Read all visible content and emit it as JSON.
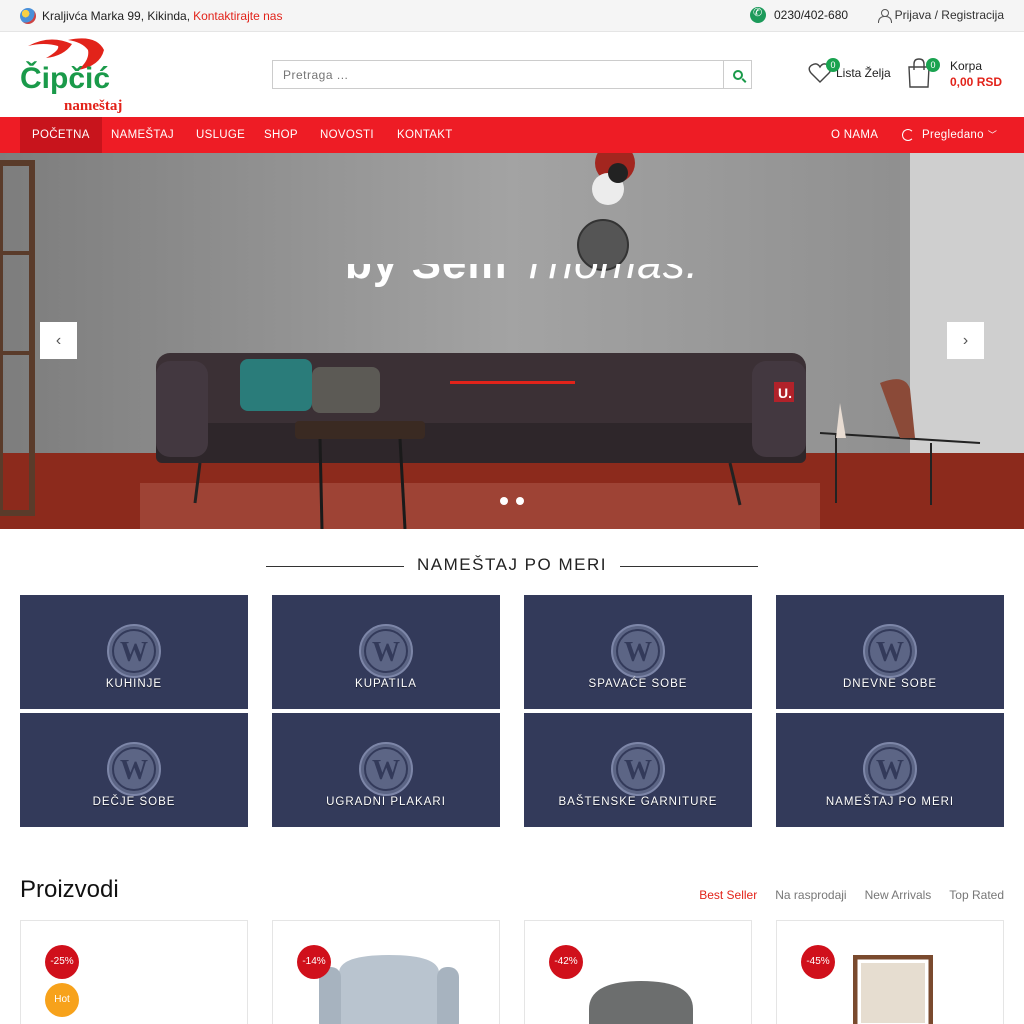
{
  "topbar": {
    "address": "Kraljivća Marka 99, Kikinda,",
    "contact_link": "Kontaktirajte nas",
    "phone": "0230/402-680",
    "login": "Prijava / Registracija"
  },
  "header": {
    "logo_main": "Čipčić",
    "logo_sub": "nameštaj",
    "search_placeholder": "Pretraga ...",
    "wishlist_label": "Lista Želja",
    "wishlist_count": "0",
    "cart_label": "Korpa",
    "cart_count": "0",
    "cart_total": "0,00 RSD"
  },
  "nav": {
    "items": [
      "POČETNA",
      "NAMEŠTAJ",
      "USLUGE",
      "SHOP",
      "NOVOSTI",
      "KONTAKT"
    ],
    "right_item": "O NAMA",
    "viewed": "Pregledano"
  },
  "hero": {
    "title_part1": "by Sem",
    "title_part2": "Thomas.",
    "prev": "‹",
    "next": "›"
  },
  "section": {
    "title": "NAMEŠTAJ PO MERI"
  },
  "categories": [
    "KUHINJE",
    "KUPATILA",
    "SPAVAĆE SOBE",
    "DNEVNE SOBE",
    "DEČJE SOBE",
    "UGRADNI PLAKARI",
    "BAŠTENSKE GARNITURE",
    "NAMEŠTAJ PO MERI"
  ],
  "products": {
    "title": "Proizvodi",
    "tabs": [
      "Best Seller",
      "Na rasprodaji",
      "New Arrivals",
      "Top Rated"
    ],
    "discounts": [
      "-25%",
      "-14%",
      "-42%",
      "-45%"
    ],
    "hot_label": "Hot"
  },
  "colors": {
    "brand_red": "#ee1c25",
    "brand_green": "#1aa350",
    "tile_bg": "#333a5a"
  }
}
